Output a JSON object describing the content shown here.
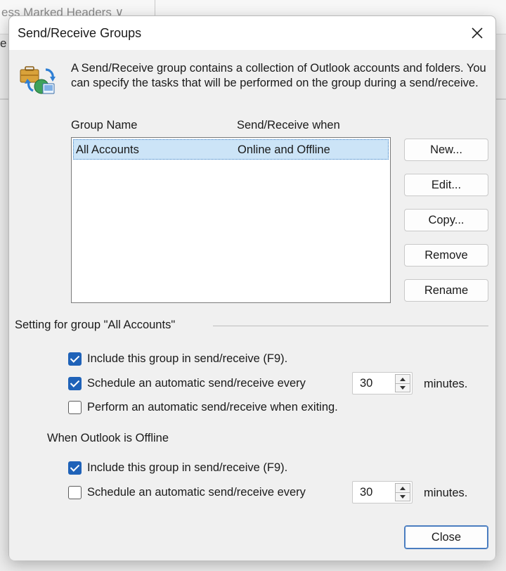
{
  "background": {
    "tab_text": "ess Marked Headers  ∨",
    "side_letter": "e"
  },
  "dialog": {
    "title": "Send/Receive Groups",
    "intro": "A Send/Receive group contains a collection of Outlook accounts and folders. You can specify the tasks that will be performed on the group during a send/receive.",
    "columns": {
      "name": "Group Name",
      "when": "Send/Receive when"
    },
    "groups": [
      {
        "name": "All Accounts",
        "when": "Online and Offline",
        "selected": true
      }
    ],
    "buttons": {
      "new": "New...",
      "edit": "Edit...",
      "copy": "Copy...",
      "remove": "Remove",
      "rename": "Rename",
      "close": "Close"
    },
    "setting_group_label": "Setting for group \"All Accounts\"",
    "online": {
      "include": {
        "label": "Include this group in send/receive (F9).",
        "checked": true
      },
      "schedule": {
        "label": "Schedule an automatic send/receive every",
        "checked": true,
        "value": "30"
      },
      "exit": {
        "label": "Perform an automatic send/receive when exiting.",
        "checked": false
      }
    },
    "offline_label": "When Outlook is Offline",
    "offline": {
      "include": {
        "label": "Include this group in send/receive (F9).",
        "checked": true
      },
      "schedule": {
        "label": "Schedule an automatic send/receive every",
        "checked": false,
        "value": "30"
      }
    },
    "minutes_label": "minutes."
  },
  "colors": {
    "accent": "#1f62b8",
    "selection": "#cce4f7",
    "close_border": "#4a7dc0"
  },
  "icons": {
    "app": "send-receive-groups-icon",
    "close": "close-icon",
    "spin_up": "spin-up-arrow-icon",
    "spin_down": "spin-down-arrow-icon"
  }
}
